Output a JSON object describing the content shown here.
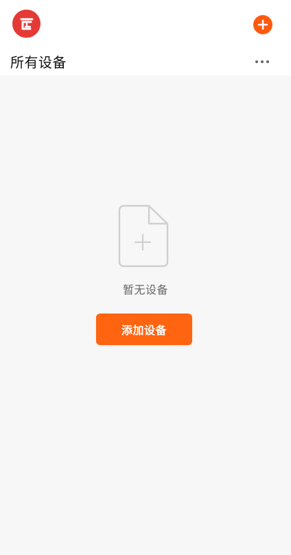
{
  "header": {
    "logo_icon": "brand-logo-icon",
    "add_icon": "plus-circle-icon"
  },
  "main": {
    "title": "所有设备",
    "more_icon": "more-dots-icon",
    "empty_state": {
      "icon": "empty-file-add-icon",
      "message": "暂无设备",
      "action_label": "添加设备"
    }
  },
  "colors": {
    "accent": "#ff6410",
    "brand_red": "#e53935",
    "background": "#f7f7f7",
    "surface": "#ffffff",
    "muted_text": "#666666"
  }
}
